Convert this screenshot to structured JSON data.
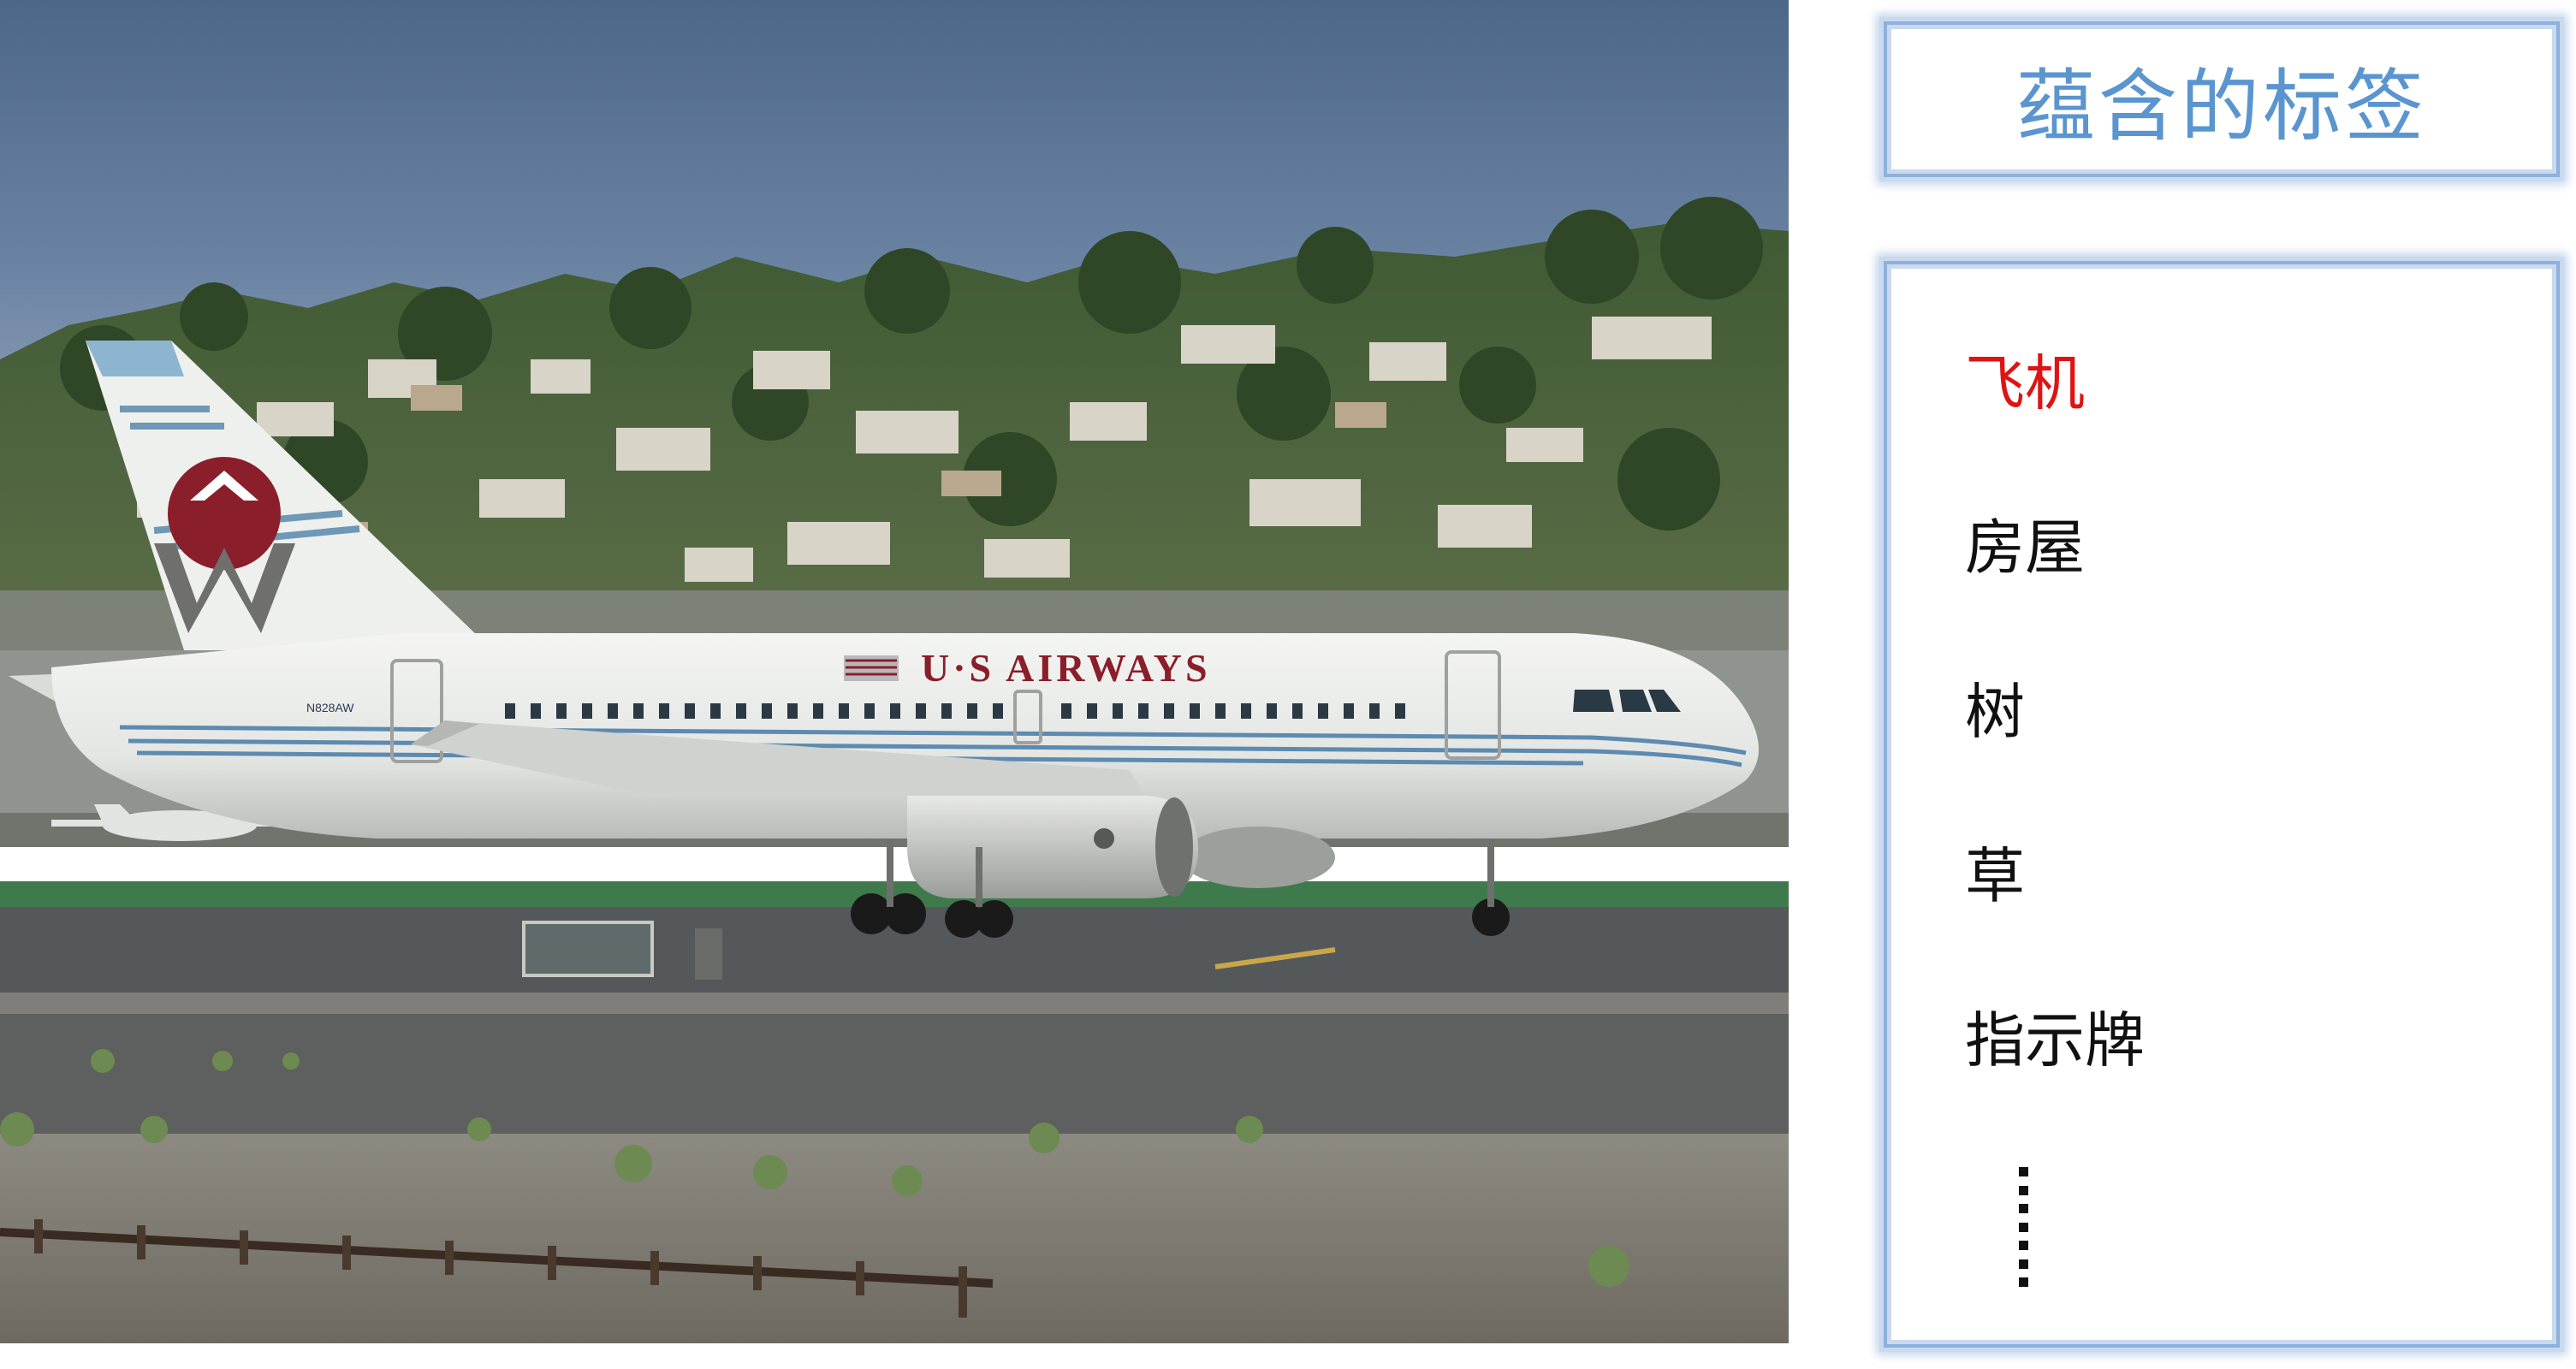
{
  "photo": {
    "aircraft_titles": "U·S AIRWAYS",
    "registration": "N828AW",
    "tail_logo_letter": "W"
  },
  "title_panel": {
    "title": "蕴含的标签"
  },
  "tags_panel": {
    "tags": [
      {
        "label": "飞机",
        "highlighted": true
      },
      {
        "label": "房屋",
        "highlighted": false
      },
      {
        "label": "树",
        "highlighted": false
      },
      {
        "label": "草",
        "highlighted": false
      },
      {
        "label": "指示牌",
        "highlighted": false
      }
    ],
    "ellipsis_icon": "vertical-ellipsis"
  },
  "colors": {
    "tag_highlight": "#e01313",
    "title_text": "#5b95d0",
    "panel_border": "#8eb0dc"
  }
}
